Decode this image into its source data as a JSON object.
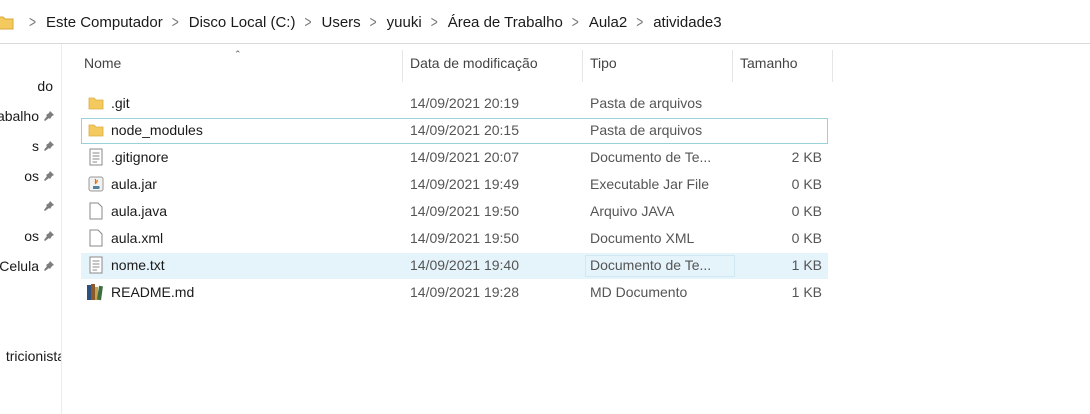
{
  "breadcrumb": [
    "Este Computador",
    "Disco Local (C:)",
    "Users",
    "yuuki",
    "Área de Trabalho",
    "Aula2",
    "atividade3"
  ],
  "nav": {
    "items": [
      {
        "label": "do",
        "pinned": false
      },
      {
        "label": "abalho",
        "pinned": true
      },
      {
        "label": "s",
        "pinned": true
      },
      {
        "label": "os",
        "pinned": true
      },
      {
        "label": "",
        "pinned": true
      },
      {
        "label": "os",
        "pinned": true
      },
      {
        "label": "Celula",
        "pinned": true
      },
      {
        "label": "tricionista",
        "pinned": false
      }
    ]
  },
  "columns": {
    "name": "Nome",
    "date": "Data de modificação",
    "type": "Tipo",
    "size": "Tamanho"
  },
  "files": [
    {
      "name": ".git",
      "date": "14/09/2021 20:19",
      "type": "Pasta de arquivos",
      "size": "",
      "icon": "folder-icon"
    },
    {
      "name": "node_modules",
      "date": "14/09/2021 20:15",
      "type": "Pasta de arquivos",
      "size": "",
      "icon": "folder-icon"
    },
    {
      "name": ".gitignore",
      "date": "14/09/2021 20:07",
      "type": "Documento de Te...",
      "size": "2 KB",
      "icon": "text-file-icon"
    },
    {
      "name": "aula.jar",
      "date": "14/09/2021 19:49",
      "type": "Executable Jar File",
      "size": "0 KB",
      "icon": "java-jar-icon"
    },
    {
      "name": "aula.java",
      "date": "14/09/2021 19:50",
      "type": "Arquivo JAVA",
      "size": "0 KB",
      "icon": "blank-file-icon"
    },
    {
      "name": "aula.xml",
      "date": "14/09/2021 19:50",
      "type": "Documento XML",
      "size": "0 KB",
      "icon": "blank-file-icon"
    },
    {
      "name": "nome.txt",
      "date": "14/09/2021 19:40",
      "type": "Documento de Te...",
      "size": "1 KB",
      "icon": "text-file-icon"
    },
    {
      "name": "README.md",
      "date": "14/09/2021 19:28",
      "type": "MD Documento",
      "size": "1 KB",
      "icon": "books-icon"
    }
  ],
  "colors": {
    "hover_row": "#e5f3fb",
    "selected_outline": "#99d1d9",
    "folder": "#f4c95d"
  }
}
